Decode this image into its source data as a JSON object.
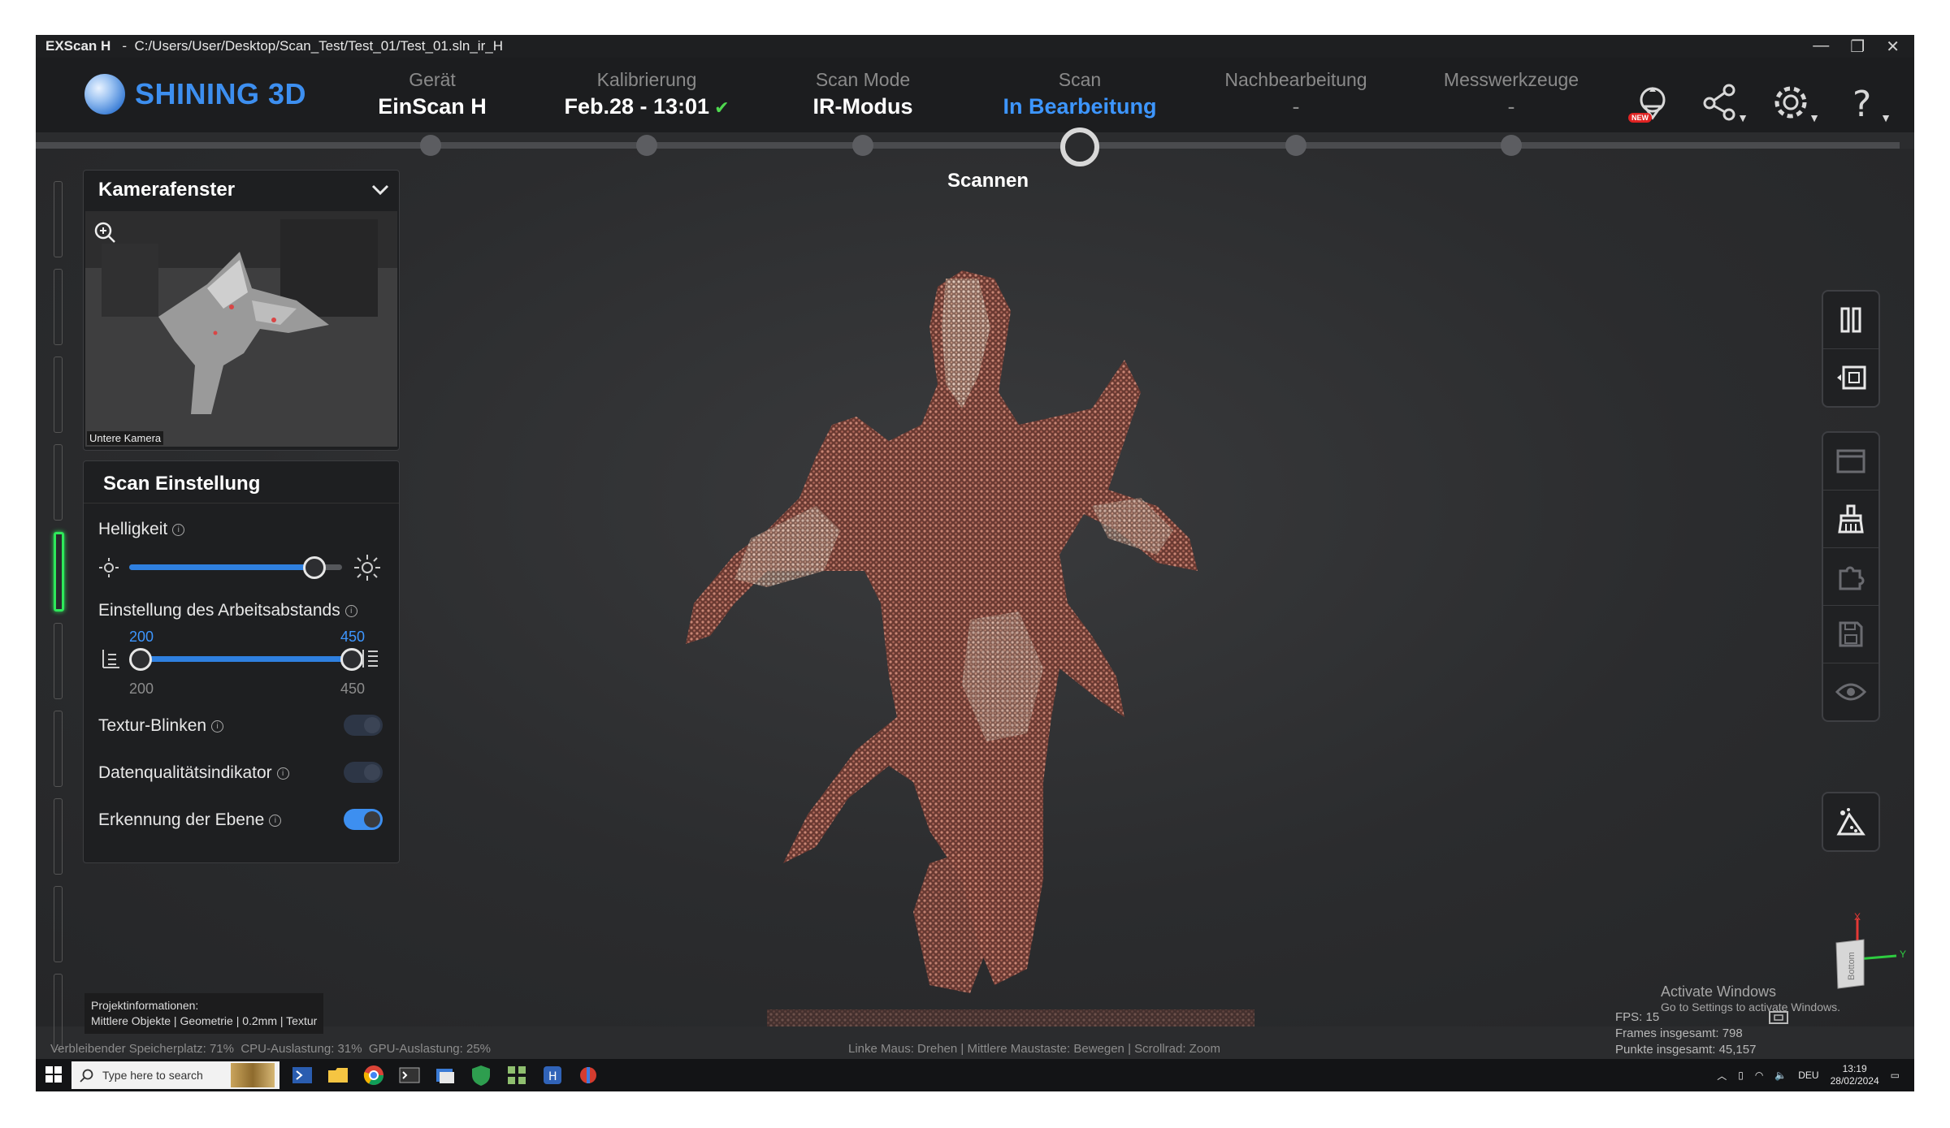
{
  "window": {
    "app_name": "EXScan H",
    "separator": "-",
    "path": "C:/Users/User/Desktop/Scan_Test/Test_01/Test_01.sln_ir_H",
    "controls": [
      "—",
      "❐",
      "✕"
    ]
  },
  "logo": {
    "text": "SHINING 3D"
  },
  "steps": [
    {
      "label": "Gerät",
      "value": "EinScan H",
      "state": "done"
    },
    {
      "label": "Kalibrierung",
      "value": "Feb.28 - 13:01",
      "check": "✔",
      "state": "done"
    },
    {
      "label": "Scan Mode",
      "value": "IR-Modus",
      "state": "done"
    },
    {
      "label": "Scan",
      "value": "In Bearbeitung",
      "state": "active"
    },
    {
      "label": "Nachbearbeitung",
      "value": "-",
      "state": "pending"
    },
    {
      "label": "Messwerkzeuge",
      "value": "-",
      "state": "pending"
    }
  ],
  "current_step_caption": "Scannen",
  "header_icons": [
    {
      "name": "update-icon",
      "badge": "NEW"
    },
    {
      "name": "share-icon"
    },
    {
      "name": "gear-icon"
    },
    {
      "name": "help-icon"
    }
  ],
  "camera_panel": {
    "title": "Kamerafenster",
    "camera_label": "Untere Kamera"
  },
  "scan_settings": {
    "title": "Scan Einstellung",
    "brightness": {
      "label": "Helligkeit",
      "value_fraction": 0.87
    },
    "working_distance": {
      "label": "Einstellung des Arbeitsabstands",
      "low": "200",
      "high": "450",
      "low_label": "200",
      "high_label": "450",
      "min": 200,
      "max": 450,
      "range_low": 200,
      "range_high": 450
    },
    "toggles": [
      {
        "label": "Textur-Blinken",
        "on": false
      },
      {
        "label": "Datenqualitätsindikator",
        "on": false
      },
      {
        "label": "Erkennung der Ebene",
        "on": true
      }
    ]
  },
  "project_info": {
    "title": "Projektinformationen:",
    "details": "Mittlere Objekte | Geometrie | 0.2mm | Textur"
  },
  "status": {
    "storage": "Verbleibender Speicherplatz: 71%",
    "cpu": "CPU-Auslastung: 31%",
    "gpu": "GPU-Auslastung: 25%",
    "mouse_hint": "Linke Maus: Drehen | Mittlere Maustaste: Bewegen | Scrollrad: Zoom"
  },
  "stats": {
    "fps": "FPS: 15",
    "frames": "Frames insgesamt: 798",
    "points": "Punkte insgesamt: 45,157"
  },
  "activate_windows": {
    "title": "Activate Windows",
    "subtitle": "Go to Settings to activate Windows."
  },
  "axis": {
    "x": "X",
    "y": "Y",
    "face": "Bottom"
  },
  "taskbar": {
    "search_placeholder": "Type here to search",
    "lang": "DEU",
    "time": "13:19",
    "date": "28/02/2024"
  },
  "colors": {
    "accent": "#3d96ff",
    "green": "#4fd84f",
    "cloud": "#b8695a"
  }
}
